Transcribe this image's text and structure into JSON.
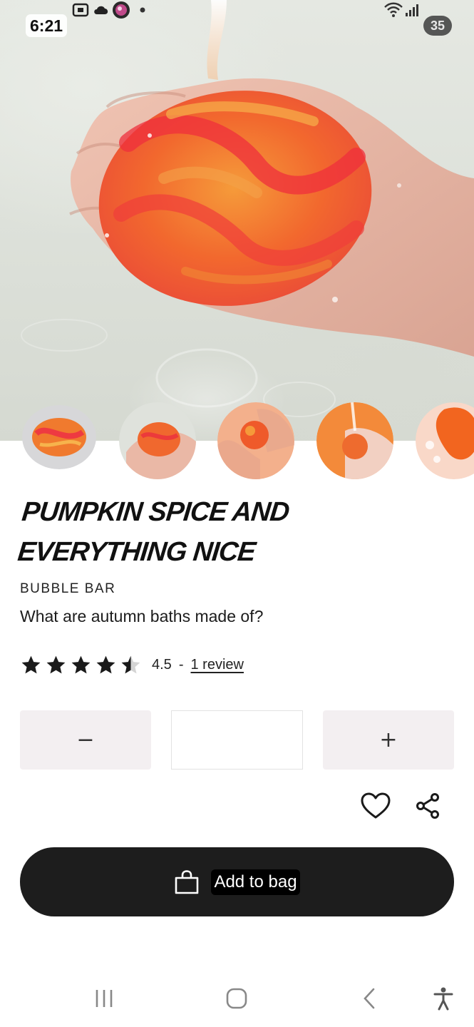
{
  "status_bar": {
    "time": "6:21",
    "battery": "35",
    "icons": [
      "screenshot-icon",
      "cloud-icon",
      "app-avatar-icon",
      "notification-dot-icon",
      "wifi-icon",
      "signal-icon"
    ]
  },
  "product": {
    "hero_image": "hand-holding-orange-bubble-bar-under-running-water",
    "thumbnails": [
      "bubble-bar-top-view",
      "bubble-bar-in-hand",
      "bubble-bar-crumbled-in-hands",
      "bubble-bar-under-tap",
      "orange-foam-bath"
    ],
    "title": "Pumpkin Spice and Everything Nice",
    "category": "Bubble Bar",
    "tagline": "What are autumn baths made of?",
    "rating": {
      "value": 4.5,
      "value_text": "4.5",
      "max": 5,
      "separator": "-",
      "reviews_label": "1 review"
    }
  },
  "quantity": {
    "decrease_label": "−",
    "value": "",
    "increase_label": "+"
  },
  "actions": {
    "wishlist_icon": "heart-icon",
    "share_icon": "share-icon",
    "add_to_bag_label": "Add to bag",
    "add_to_bag_icon": "shopping-bag-icon"
  },
  "nav_bar": {
    "buttons": [
      "recent-apps-icon",
      "home-icon",
      "back-icon",
      "accessibility-icon"
    ]
  },
  "colors": {
    "primary_button": "#1d1d1d",
    "stepper_bg": "#f3eff1",
    "text": "#1c1c1c",
    "product_orange": "#f27a2a",
    "product_red": "#ef3b3b"
  }
}
